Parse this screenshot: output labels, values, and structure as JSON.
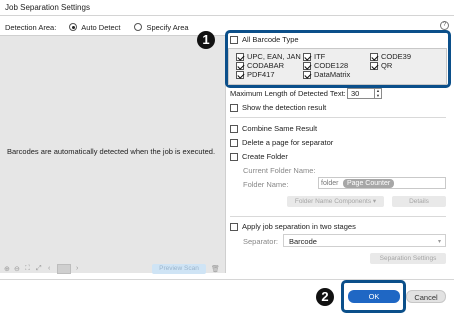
{
  "window": {
    "title": "Job Separation Settings"
  },
  "detection": {
    "label": "Detection Area:",
    "auto_label": "Auto Detect",
    "specify_label": "Specify Area",
    "selected": "Auto Detect"
  },
  "preview": {
    "message": "Barcodes are automatically detected when the job is executed.",
    "preview_scan_label": "Preview Scan"
  },
  "barcode": {
    "all_label": "All Barcode Type",
    "all_checked": false,
    "types": [
      {
        "label": "UPC, EAN, JAN",
        "checked": true
      },
      {
        "label": "ITF",
        "checked": true
      },
      {
        "label": "CODE39",
        "checked": true
      },
      {
        "label": "CODABAR",
        "checked": true
      },
      {
        "label": "CODE128",
        "checked": true
      },
      {
        "label": "QR",
        "checked": true
      },
      {
        "label": "PDF417",
        "checked": true
      },
      {
        "label": "DataMatrix",
        "checked": true
      }
    ]
  },
  "options": {
    "max_length_label": "Maximum Length of Detected Text:",
    "max_length_value": "30",
    "show_result_label": "Show the detection result",
    "combine_label": "Combine Same Result",
    "delete_page_label": "Delete a page for separator",
    "create_folder_label": "Create Folder",
    "current_folder_label": "Current Folder Name:",
    "folder_name_label": "Folder Name:",
    "folder_prefix": "folder",
    "folder_token": "Page Counter",
    "folder_components_label": "Folder Name Components",
    "details_label": "Details",
    "two_stage_label": "Apply job separation in two stages",
    "separator_label": "Separator:",
    "separator_value": "Barcode",
    "separation_settings_label": "Separation Settings"
  },
  "markers": {
    "one": "1",
    "two": "2"
  },
  "footer": {
    "ok_label": "OK",
    "cancel_label": "Cancel"
  },
  "colors": {
    "highlight": "#0b4f8a",
    "primary": "#1f67c4"
  }
}
